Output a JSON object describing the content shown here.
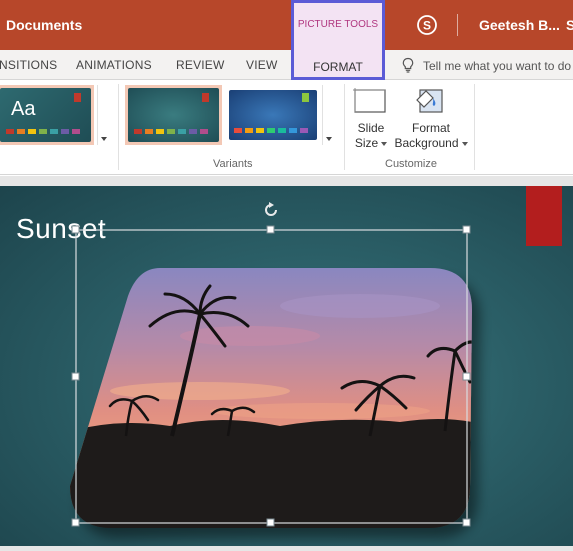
{
  "titlebar": {
    "doc_title": "Documents",
    "user_name": "Geetesh B...",
    "user_trailing": "S",
    "bg_color": "#b7472a",
    "skype_icon": "skype-icon"
  },
  "contextual_tab": {
    "header": "PICTURE TOOLS",
    "tab": "FORMAT",
    "highlight_color": "#5b5bd6"
  },
  "tabs": [
    {
      "label": "NSITIONS"
    },
    {
      "label": "ANIMATIONS"
    },
    {
      "label": "REVIEW"
    },
    {
      "label": "VIEW"
    }
  ],
  "tell_me": {
    "text": "Tell me what you want to do",
    "icon": "lightbulb-icon"
  },
  "ribbon": {
    "themes": {
      "sample_text": "Aa"
    },
    "variants": {
      "label": "Variants"
    },
    "customize": {
      "label": "Customize",
      "slide_size_line1": "Slide",
      "slide_size_line2": "Size",
      "format_bg_line1": "Format",
      "format_bg_line2": "Background"
    }
  },
  "slide": {
    "title": "Sunset",
    "accent_color": "#b31e1e"
  }
}
